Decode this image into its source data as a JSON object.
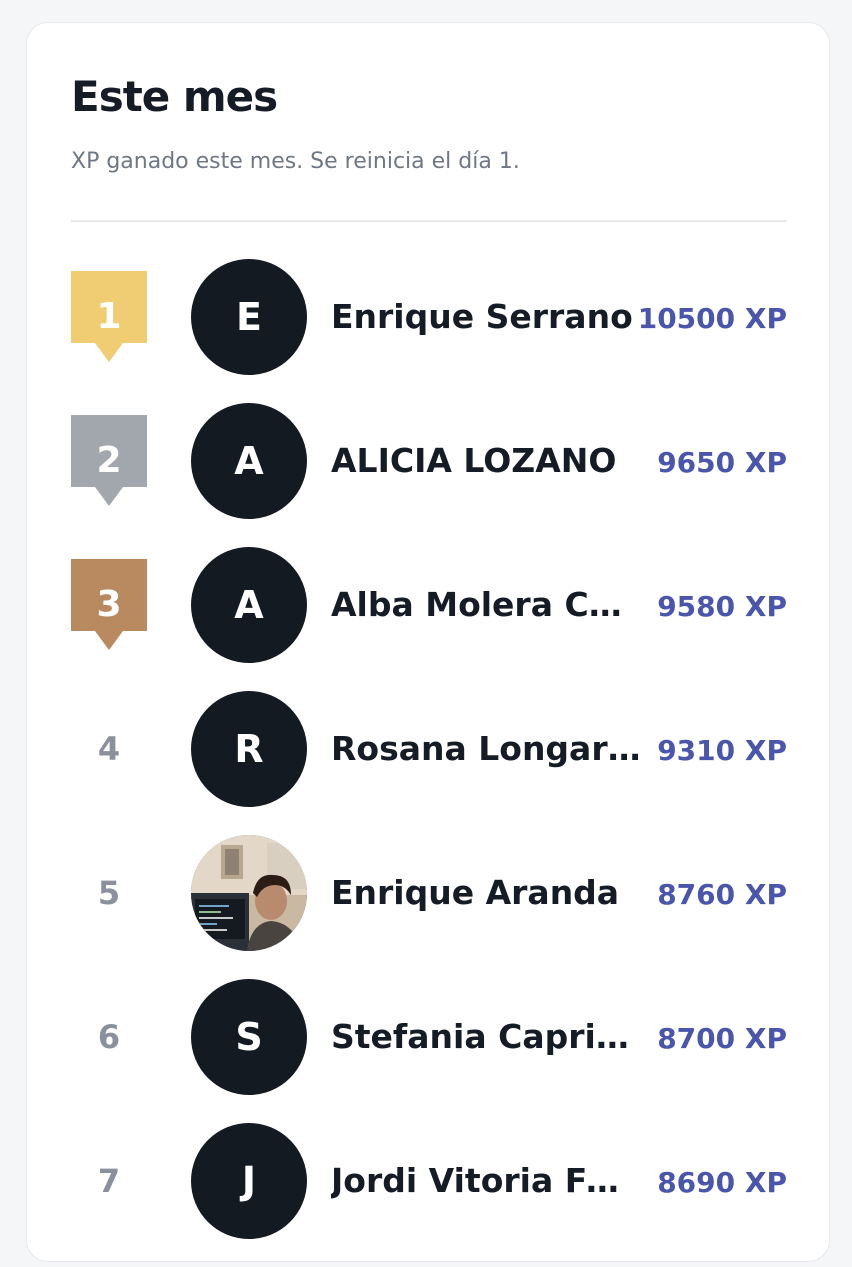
{
  "header": {
    "title": "Este mes",
    "subtitle": "XP ganado este mes. Se reinicia el día 1."
  },
  "colors": {
    "gold": "#f0cd72",
    "silver": "#a2a7ae",
    "bronze": "#b98a60",
    "avatar_bg": "#131a22",
    "xp_text": "#4a56ab"
  },
  "leaderboard": [
    {
      "rank": "1",
      "initial": "E",
      "name": "Enrique Serrano",
      "xp": "10500 XP",
      "medal": "gold"
    },
    {
      "rank": "2",
      "initial": "A",
      "name": "ALICIA LOZANO",
      "xp": "9650 XP",
      "medal": "silver"
    },
    {
      "rank": "3",
      "initial": "A",
      "name": "Alba Molera Chaves",
      "xp": "9580 XP",
      "medal": "bronze"
    },
    {
      "rank": "4",
      "initial": "R",
      "name": "Rosana Longares",
      "xp": "9310 XP",
      "medal": null
    },
    {
      "rank": "5",
      "initial": "",
      "name": "Enrique Aranda",
      "xp": "8760 XP",
      "medal": null,
      "photo": true
    },
    {
      "rank": "6",
      "initial": "S",
      "name": "Stefania Capriotti",
      "xp": "8700 XP",
      "medal": null
    },
    {
      "rank": "7",
      "initial": "J",
      "name": "Jordi Vitoria Feixas",
      "xp": "8690 XP",
      "medal": null
    }
  ]
}
